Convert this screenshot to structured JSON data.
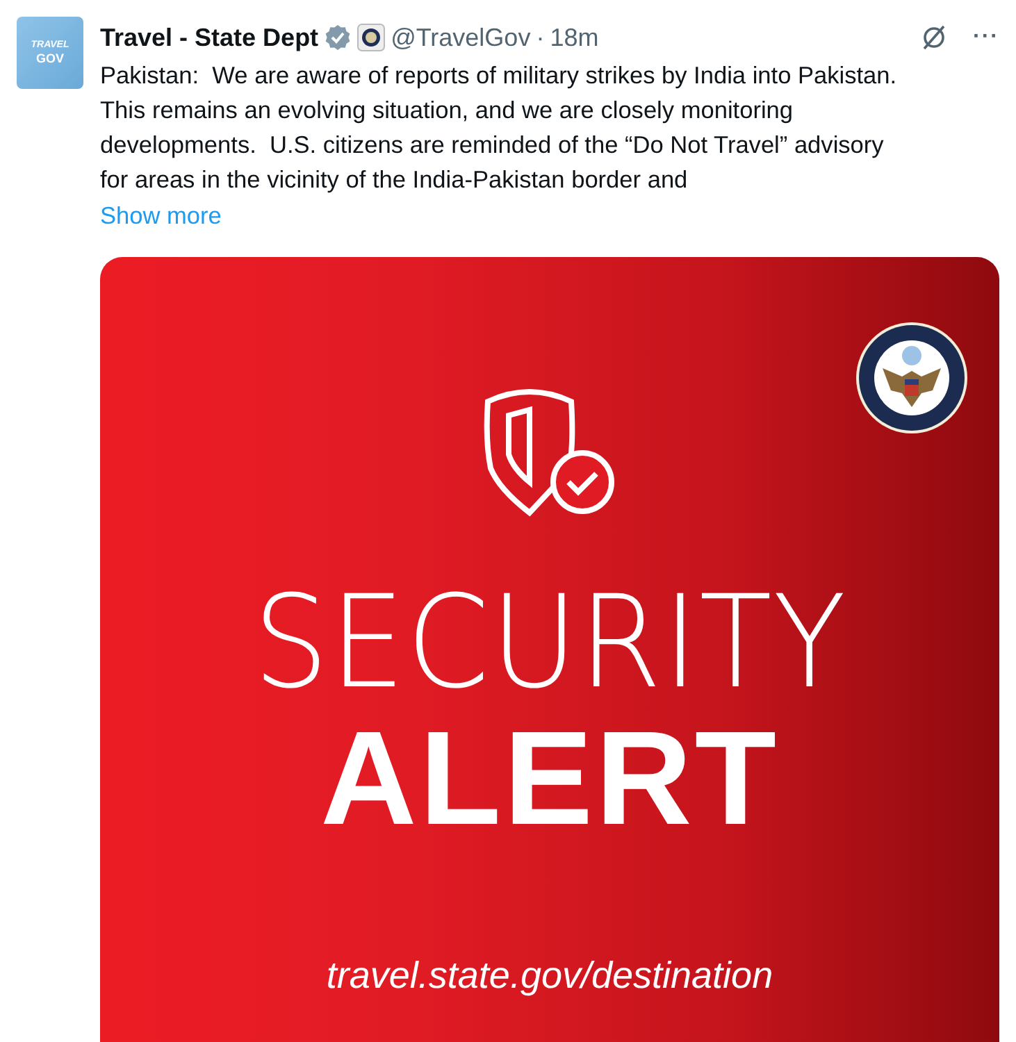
{
  "post": {
    "avatar_text": [
      "TRAVEL",
      "GOV"
    ],
    "author": "Travel - State Dept",
    "verified": true,
    "handle": "@TravelGov",
    "separator": "·",
    "time": "18m",
    "more": "···",
    "body_lines": [
      "Pakistan:  We are aware of reports of military strikes by India into Pakistan.",
      "This remains an evolving situation, and we are closely monitoring",
      "developments.  U.S. citizens are reminded of the “Do Not Travel” advisory",
      "for areas in the vicinity of the India-Pakistan border and"
    ],
    "show_more": "Show more",
    "media": {
      "headline_1": "SECURITY",
      "headline_2": "ALERT",
      "url": "travel.state.gov/destination"
    }
  }
}
